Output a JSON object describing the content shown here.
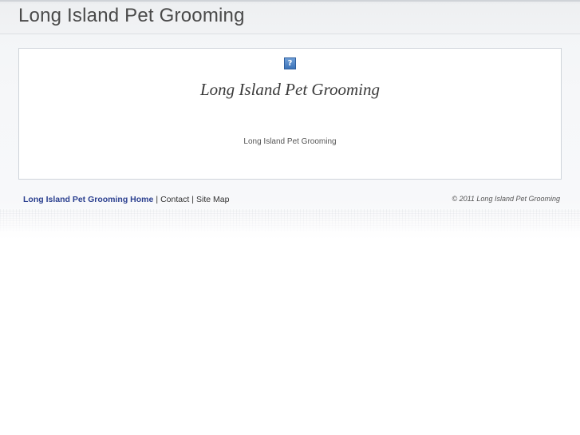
{
  "header": {
    "site_title": "Long Island Pet Grooming"
  },
  "content": {
    "image_placeholder": "?",
    "heading": "Long Island Pet Grooming",
    "body_text": "Long Island Pet Grooming"
  },
  "footer": {
    "nav": [
      {
        "label": "Long Island Pet Grooming Home"
      },
      {
        "label": "Contact"
      },
      {
        "label": "Site Map"
      }
    ],
    "separator": "|",
    "copyright": "© 2011 Long Island Pet Grooming"
  },
  "colors": {
    "link_home": "#2a3f8f",
    "text": "#333333",
    "title": "#4a4a4a"
  }
}
